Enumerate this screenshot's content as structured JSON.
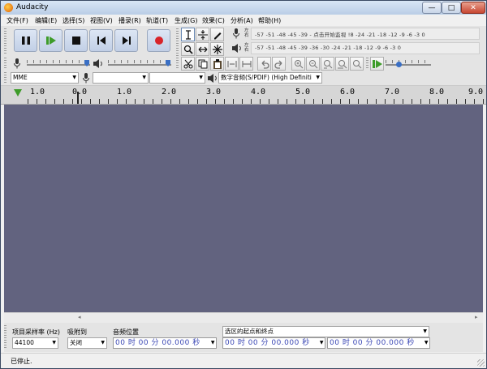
{
  "window": {
    "title": "Audacity",
    "controls": {
      "minimize": "—",
      "maximize": "□",
      "close": "✕"
    }
  },
  "menu": [
    "文件(F)",
    "编辑(E)",
    "选择(S)",
    "视图(V)",
    "播录(R)",
    "轨道(T)",
    "生成(G)",
    "效果(C)",
    "分析(A)",
    "帮助(H)"
  ],
  "meters": {
    "record_scale": "-57 -51 -48 -45 -39 - 点击开始监视 !8 -24 -21 -18 -12 -9 -6 -3 0",
    "playback_scale": "-57 -51 -48 -45 -39 -36 -30 -24 -21 -18 -12 -9 -6 -3 0",
    "left": "左",
    "right": "右"
  },
  "sliders": {
    "recording_volume": 0.97,
    "playback_volume": 0.97,
    "play_at_speed": 0.33
  },
  "device": {
    "host": "MME",
    "recording_device": "",
    "recording_channels": "",
    "playback_device": "数字音频(S/PDIF) (High Definiti"
  },
  "ruler": {
    "labels": [
      "1.0",
      "0.0",
      "1.0",
      "2.0",
      "3.0",
      "4.0",
      "5.0",
      "6.0",
      "7.0",
      "8.0",
      "9.0"
    ]
  },
  "selection_bar": {
    "rate_label": "项目采样率 (Hz)",
    "rate_value": "44100",
    "snap_label": "吸附到",
    "snap_value": "关闭",
    "position_label": "音频位置",
    "position_value": "00 时 00 分 00.000 秒",
    "selection_mode": "选区的起点和终点",
    "start_value": "00 时 00 分 00.000 秒",
    "end_value": "00 时 00 分 00.000 秒"
  },
  "status": {
    "text": "已停止."
  },
  "colors": {
    "track_area": "#62637f",
    "record_button": "#d8242a",
    "playhead": "#3e9c2a",
    "time_text": "#3a47b5"
  }
}
